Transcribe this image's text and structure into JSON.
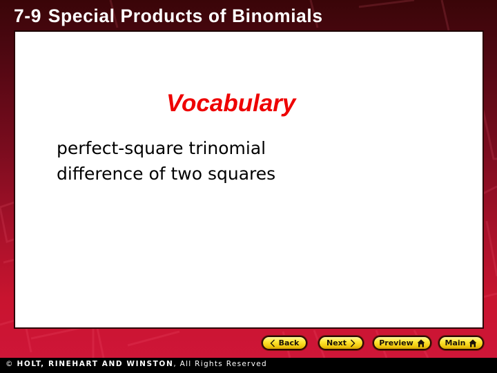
{
  "header": {
    "lesson_number": "7-9",
    "title": "Special Products of Binomials"
  },
  "content": {
    "heading": "Vocabulary",
    "terms": [
      "perfect-square trinomial",
      "difference of two squares"
    ]
  },
  "navigation": {
    "back_label": "Back",
    "next_label": "Next",
    "preview_label": "Preview",
    "main_label": "Main",
    "back_icon": "chevron-left-icon",
    "next_icon": "chevron-right-icon",
    "preview_icon": "home-icon",
    "main_icon": "home-icon"
  },
  "footer": {
    "copyright_symbol": "©",
    "publisher": "HOLT, RINEHART AND WINSTON",
    "rights": ", All Rights Reserved"
  },
  "colors": {
    "heading_red": "#ee0000",
    "button_yellow": "#ffe83a",
    "background_top": "#3a0508",
    "background_bottom": "#d0163a"
  }
}
